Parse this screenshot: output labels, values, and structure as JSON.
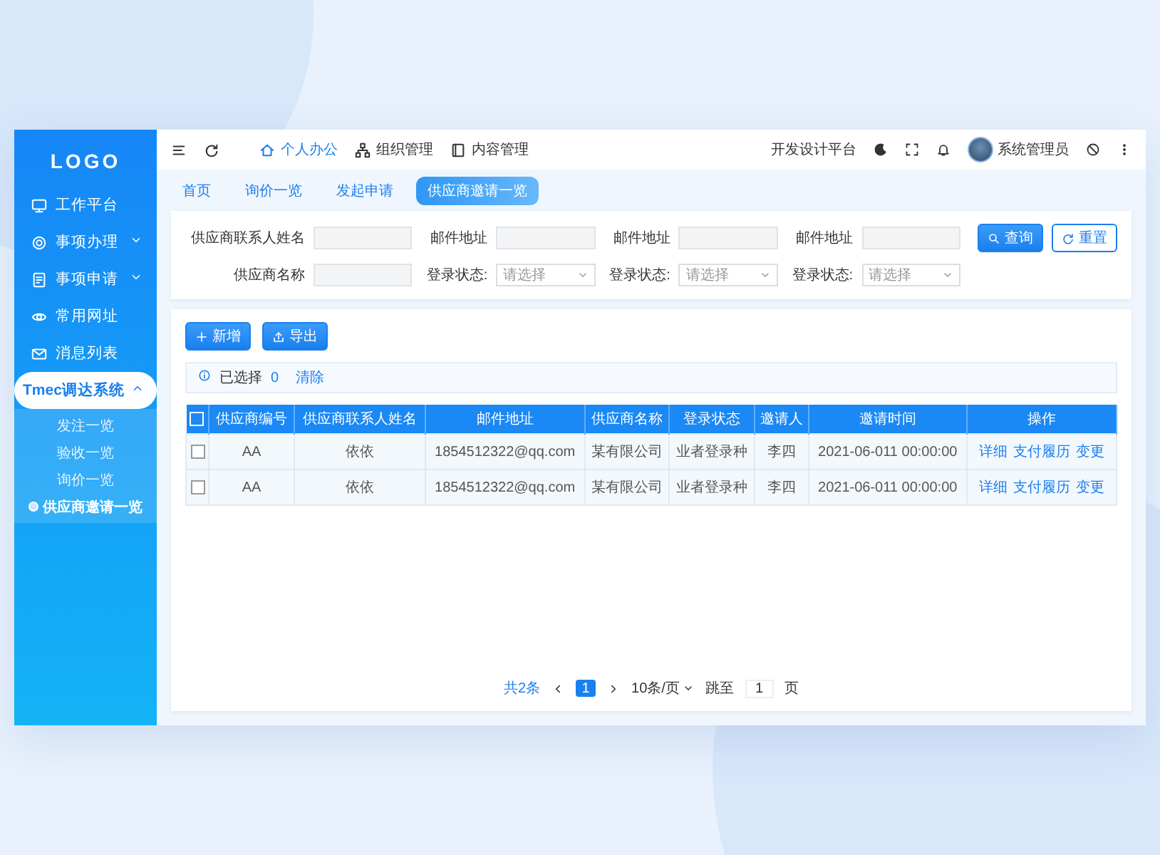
{
  "sidebar": {
    "logo": "LOGO",
    "items": [
      {
        "label": "工作平台",
        "selected": false
      },
      {
        "label": "事项办理",
        "selected": false,
        "expanded": false
      },
      {
        "label": "事项申请",
        "selected": false,
        "expanded": false
      },
      {
        "label": "常用网址",
        "selected": false
      },
      {
        "label": "消息列表",
        "selected": false
      },
      {
        "label": "Tmec调达系统",
        "selected": true,
        "expanded": true,
        "children": [
          {
            "label": "发注一览",
            "selected": false
          },
          {
            "label": "验收一览",
            "selected": false
          },
          {
            "label": "询价一览",
            "selected": false
          },
          {
            "label": "供应商邀请一览",
            "selected": true
          }
        ]
      }
    ]
  },
  "topbar": {
    "nav": [
      {
        "label": "个人办公",
        "selected": true
      },
      {
        "label": "组织管理",
        "selected": false
      },
      {
        "label": "内容管理",
        "selected": false
      }
    ],
    "platform": "开发设计平台",
    "user": "系统管理员"
  },
  "tabs": [
    {
      "label": "首页",
      "selected": false
    },
    {
      "label": "询价一览",
      "selected": false
    },
    {
      "label": "发起申请",
      "selected": false
    },
    {
      "label": "供应商邀请一览",
      "selected": true
    }
  ],
  "filters": [
    {
      "kind": "input",
      "label": "供应商联系人姓名"
    },
    {
      "kind": "input",
      "label": "邮件地址"
    },
    {
      "kind": "input",
      "label": "邮件地址"
    },
    {
      "kind": "input",
      "label": "邮件地址"
    },
    {
      "kind": "input",
      "label": "供应商名称"
    },
    {
      "kind": "select",
      "label": "登录状态:",
      "placeholder": "请选择"
    },
    {
      "kind": "select",
      "label": "登录状态:",
      "placeholder": "请选择"
    },
    {
      "kind": "select",
      "label": "登录状态:",
      "placeholder": "请选择"
    }
  ],
  "filter_buttons": [
    {
      "label": "查询",
      "primary": true
    },
    {
      "label": "重置",
      "primary": false
    }
  ],
  "actions": [
    "新增",
    "导出"
  ],
  "selection": {
    "label": "已选择",
    "count": "0",
    "clear": "清除"
  },
  "table": {
    "header_checked": false,
    "columns": [
      "供应商编号",
      "供应商联系人姓名",
      "邮件地址",
      "供应商名称",
      "登录状态",
      "邀请人",
      "邀请时间",
      "操作"
    ],
    "rows": [
      {
        "checked": false,
        "cells": [
          "AA",
          "依依",
          "1854512322@qq.com",
          "某有限公司",
          "业者登录种",
          "李四",
          "2021-06-011 00:00:00"
        ],
        "actions": [
          "详细",
          "支付履历",
          "变更"
        ]
      },
      {
        "checked": false,
        "cells": [
          "AA",
          "依依",
          "1854512322@qq.com",
          "某有限公司",
          "业者登录种",
          "李四",
          "2021-06-011 00:00:00"
        ],
        "actions": [
          "详细",
          "支付履历",
          "变更"
        ]
      }
    ]
  },
  "pagination": {
    "total": "共2条",
    "pages": [
      {
        "label": "1",
        "selected": true
      }
    ],
    "page_size": "10条/页",
    "jump_label": "跳至",
    "jump_value": "1",
    "page_unit": "页"
  }
}
